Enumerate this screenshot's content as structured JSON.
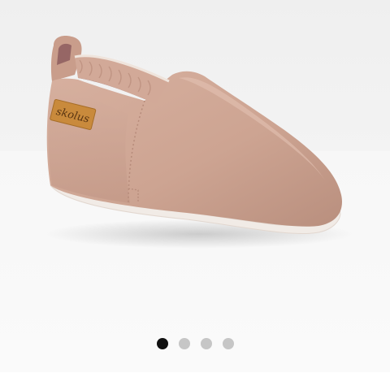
{
  "gallery": {
    "image_label": "skolus",
    "total_slides": 4,
    "active_slide": 1,
    "dots": [
      {
        "active": true
      },
      {
        "active": false
      },
      {
        "active": false
      },
      {
        "active": false
      }
    ]
  },
  "colors": {
    "shoe_leather": "#cfa593",
    "shoe_shadow": "#a97e6d",
    "lining": "#8d5d5e",
    "label_tag": "#c98a3c",
    "sole": "#f1ebe6",
    "active_dot": "#111111",
    "inactive_dot": "#c6c6c6"
  }
}
